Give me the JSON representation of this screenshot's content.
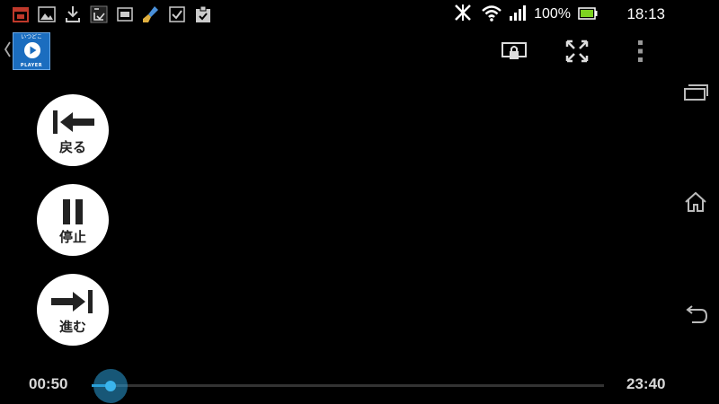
{
  "status_bar": {
    "notification_icons": [
      "calendar-icon",
      "gallery-icon",
      "download-icon",
      "task-icon",
      "note-icon",
      "cleaner-icon",
      "checkbox-icon",
      "clipboard-check-icon"
    ],
    "battery_percent": "100%",
    "clock": "18:13"
  },
  "app_bar": {
    "logo_top": "いつどこ",
    "logo_bottom": "PLAYER",
    "actions": [
      "cast-lock-icon",
      "fullscreen-icon",
      "overflow-menu-icon"
    ]
  },
  "controls": {
    "back_label": "戻る",
    "pause_label": "停止",
    "forward_label": "進む"
  },
  "seek": {
    "current_time": "00:50",
    "total_time": "23:40",
    "progress": 0.036
  },
  "colors": {
    "accent": "#2a9fd8",
    "logo_bg": "#1b6dbf",
    "battery": "#7ed321"
  }
}
